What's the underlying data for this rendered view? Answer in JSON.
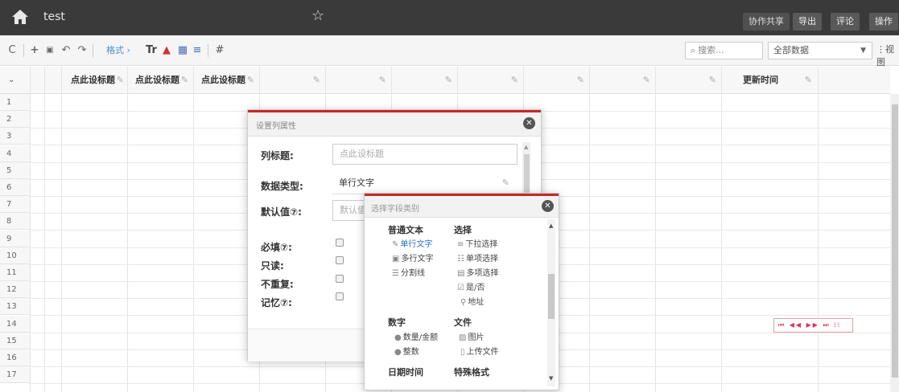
{
  "topbar": {
    "title": "test",
    "buttons": {
      "collab": "协作共享",
      "export": "导出",
      "comment": "评论",
      "ops": "操作"
    }
  },
  "toolbar": {
    "format_label": "格式",
    "search_placeholder": "搜索...",
    "filter_value": "全部数据",
    "view_label": "视图"
  },
  "grid": {
    "headers": [
      "点此设标题",
      "点此设标题",
      "点此设标题",
      "",
      "",
      "",
      "",
      "",
      "",
      "",
      "更新时间"
    ],
    "rows": [
      "1",
      "2",
      "3",
      "4",
      "5",
      "6",
      "7",
      "8",
      "9",
      "10",
      "11",
      "12",
      "13",
      "14",
      "15",
      "16",
      "17"
    ]
  },
  "dialog_column": {
    "title": "设置列属性",
    "labels": {
      "col_title": "列标题:",
      "data_type": "数据类型:",
      "default": "默认值⑦:",
      "required": "必填⑦:",
      "readonly": "只读:",
      "unique": "不重复:",
      "memory": "记忆⑦:"
    },
    "col_title_placeholder": "点此设标题",
    "data_type_value": "单行文字",
    "default_placeholder": "默认值"
  },
  "dialog_type": {
    "title": "选择字段类别",
    "groups": {
      "text": "普通文本",
      "choice": "选择",
      "number": "数字",
      "file": "文件",
      "datetime": "日期时间",
      "special": "特殊格式"
    },
    "options": {
      "single_line": "单行文字",
      "multi_line": "多行文字",
      "divider": "分割线",
      "dropdown": "下拉选择",
      "single_choice": "单项选择",
      "multi_choice": "多项选择",
      "yes_no": "是/否",
      "address": "地址",
      "amount": "数量/金额",
      "integer": "整数",
      "image": "图片",
      "upload": "上传文件"
    }
  }
}
